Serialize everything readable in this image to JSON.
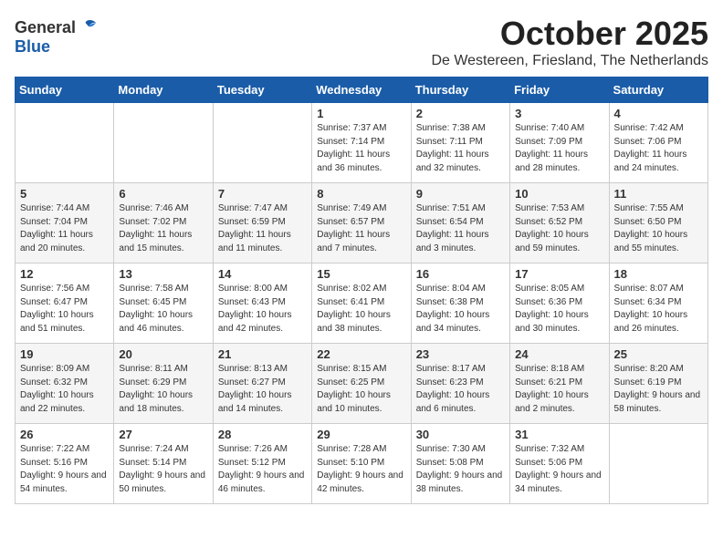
{
  "header": {
    "logo_general": "General",
    "logo_blue": "Blue",
    "title": "October 2025",
    "subtitle": "De Westereen, Friesland, The Netherlands"
  },
  "days_of_week": [
    "Sunday",
    "Monday",
    "Tuesday",
    "Wednesday",
    "Thursday",
    "Friday",
    "Saturday"
  ],
  "weeks": [
    [
      {
        "day": "",
        "info": ""
      },
      {
        "day": "",
        "info": ""
      },
      {
        "day": "",
        "info": ""
      },
      {
        "day": "1",
        "info": "Sunrise: 7:37 AM\nSunset: 7:14 PM\nDaylight: 11 hours and 36 minutes."
      },
      {
        "day": "2",
        "info": "Sunrise: 7:38 AM\nSunset: 7:11 PM\nDaylight: 11 hours and 32 minutes."
      },
      {
        "day": "3",
        "info": "Sunrise: 7:40 AM\nSunset: 7:09 PM\nDaylight: 11 hours and 28 minutes."
      },
      {
        "day": "4",
        "info": "Sunrise: 7:42 AM\nSunset: 7:06 PM\nDaylight: 11 hours and 24 minutes."
      }
    ],
    [
      {
        "day": "5",
        "info": "Sunrise: 7:44 AM\nSunset: 7:04 PM\nDaylight: 11 hours and 20 minutes."
      },
      {
        "day": "6",
        "info": "Sunrise: 7:46 AM\nSunset: 7:02 PM\nDaylight: 11 hours and 15 minutes."
      },
      {
        "day": "7",
        "info": "Sunrise: 7:47 AM\nSunset: 6:59 PM\nDaylight: 11 hours and 11 minutes."
      },
      {
        "day": "8",
        "info": "Sunrise: 7:49 AM\nSunset: 6:57 PM\nDaylight: 11 hours and 7 minutes."
      },
      {
        "day": "9",
        "info": "Sunrise: 7:51 AM\nSunset: 6:54 PM\nDaylight: 11 hours and 3 minutes."
      },
      {
        "day": "10",
        "info": "Sunrise: 7:53 AM\nSunset: 6:52 PM\nDaylight: 10 hours and 59 minutes."
      },
      {
        "day": "11",
        "info": "Sunrise: 7:55 AM\nSunset: 6:50 PM\nDaylight: 10 hours and 55 minutes."
      }
    ],
    [
      {
        "day": "12",
        "info": "Sunrise: 7:56 AM\nSunset: 6:47 PM\nDaylight: 10 hours and 51 minutes."
      },
      {
        "day": "13",
        "info": "Sunrise: 7:58 AM\nSunset: 6:45 PM\nDaylight: 10 hours and 46 minutes."
      },
      {
        "day": "14",
        "info": "Sunrise: 8:00 AM\nSunset: 6:43 PM\nDaylight: 10 hours and 42 minutes."
      },
      {
        "day": "15",
        "info": "Sunrise: 8:02 AM\nSunset: 6:41 PM\nDaylight: 10 hours and 38 minutes."
      },
      {
        "day": "16",
        "info": "Sunrise: 8:04 AM\nSunset: 6:38 PM\nDaylight: 10 hours and 34 minutes."
      },
      {
        "day": "17",
        "info": "Sunrise: 8:05 AM\nSunset: 6:36 PM\nDaylight: 10 hours and 30 minutes."
      },
      {
        "day": "18",
        "info": "Sunrise: 8:07 AM\nSunset: 6:34 PM\nDaylight: 10 hours and 26 minutes."
      }
    ],
    [
      {
        "day": "19",
        "info": "Sunrise: 8:09 AM\nSunset: 6:32 PM\nDaylight: 10 hours and 22 minutes."
      },
      {
        "day": "20",
        "info": "Sunrise: 8:11 AM\nSunset: 6:29 PM\nDaylight: 10 hours and 18 minutes."
      },
      {
        "day": "21",
        "info": "Sunrise: 8:13 AM\nSunset: 6:27 PM\nDaylight: 10 hours and 14 minutes."
      },
      {
        "day": "22",
        "info": "Sunrise: 8:15 AM\nSunset: 6:25 PM\nDaylight: 10 hours and 10 minutes."
      },
      {
        "day": "23",
        "info": "Sunrise: 8:17 AM\nSunset: 6:23 PM\nDaylight: 10 hours and 6 minutes."
      },
      {
        "day": "24",
        "info": "Sunrise: 8:18 AM\nSunset: 6:21 PM\nDaylight: 10 hours and 2 minutes."
      },
      {
        "day": "25",
        "info": "Sunrise: 8:20 AM\nSunset: 6:19 PM\nDaylight: 9 hours and 58 minutes."
      }
    ],
    [
      {
        "day": "26",
        "info": "Sunrise: 7:22 AM\nSunset: 5:16 PM\nDaylight: 9 hours and 54 minutes."
      },
      {
        "day": "27",
        "info": "Sunrise: 7:24 AM\nSunset: 5:14 PM\nDaylight: 9 hours and 50 minutes."
      },
      {
        "day": "28",
        "info": "Sunrise: 7:26 AM\nSunset: 5:12 PM\nDaylight: 9 hours and 46 minutes."
      },
      {
        "day": "29",
        "info": "Sunrise: 7:28 AM\nSunset: 5:10 PM\nDaylight: 9 hours and 42 minutes."
      },
      {
        "day": "30",
        "info": "Sunrise: 7:30 AM\nSunset: 5:08 PM\nDaylight: 9 hours and 38 minutes."
      },
      {
        "day": "31",
        "info": "Sunrise: 7:32 AM\nSunset: 5:06 PM\nDaylight: 9 hours and 34 minutes."
      },
      {
        "day": "",
        "info": ""
      }
    ]
  ]
}
